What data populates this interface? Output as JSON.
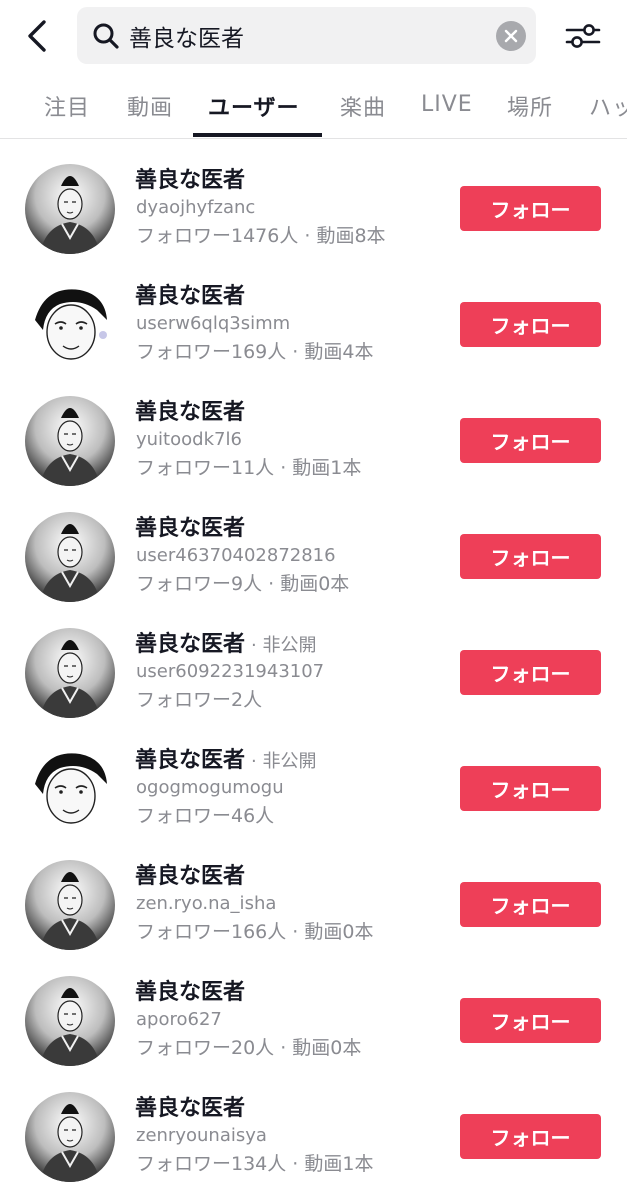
{
  "search": {
    "query": "善良な医者"
  },
  "icons": {
    "back": "chevron-left-icon",
    "search": "search-icon",
    "clear": "close-icon",
    "filter": "filter-sliders-icon",
    "avatar": "portrait-illustration-icon"
  },
  "tabs": [
    {
      "label": "注目",
      "active": false
    },
    {
      "label": "動画",
      "active": false
    },
    {
      "label": "ユーザー",
      "active": true
    },
    {
      "label": "楽曲",
      "active": false
    },
    {
      "label": "LIVE",
      "active": false
    },
    {
      "label": "場所",
      "active": false
    },
    {
      "label": "ハッ",
      "active": false
    }
  ],
  "users": [
    {
      "name": "善良な医者",
      "private": "",
      "username": "dyaojhyfzanc",
      "stats": "フォロワー1476人 · 動画8本",
      "button": "フォロー"
    },
    {
      "name": "善良な医者",
      "private": "",
      "username": "userw6qlq3simm",
      "stats": "フォロワー169人 · 動画4本",
      "button": "フォロー"
    },
    {
      "name": "善良な医者",
      "private": "",
      "username": "yuitoodk7l6",
      "stats": "フォロワー11人 · 動画1本",
      "button": "フォロー"
    },
    {
      "name": "善良な医者",
      "private": "",
      "username": "user46370402872816",
      "stats": "フォロワー9人 · 動画0本",
      "button": "フォロー"
    },
    {
      "name": "善良な医者",
      "private": "· 非公開",
      "username": "user6092231943107",
      "stats": "フォロワー2人",
      "button": "フォロー"
    },
    {
      "name": "善良な医者",
      "private": "· 非公開",
      "username": "ogogmogumogu",
      "stats": "フォロワー46人",
      "button": "フォロー"
    },
    {
      "name": "善良な医者",
      "private": "",
      "username": "zen.ryo.na_isha",
      "stats": "フォロワー166人 · 動画0本",
      "button": "フォロー"
    },
    {
      "name": "善良な医者",
      "private": "",
      "username": "aporo627",
      "stats": "フォロワー20人 · 動画0本",
      "button": "フォロー"
    },
    {
      "name": "善良な医者",
      "private": "",
      "username": "zenryounaisya",
      "stats": "フォロワー134人 · 動画1本",
      "button": "フォロー"
    }
  ],
  "colors": {
    "follow_button": "#ee3f58",
    "primary_text": "#161823",
    "secondary_text": "#8a8b91",
    "search_bg": "#f1f1f2"
  }
}
